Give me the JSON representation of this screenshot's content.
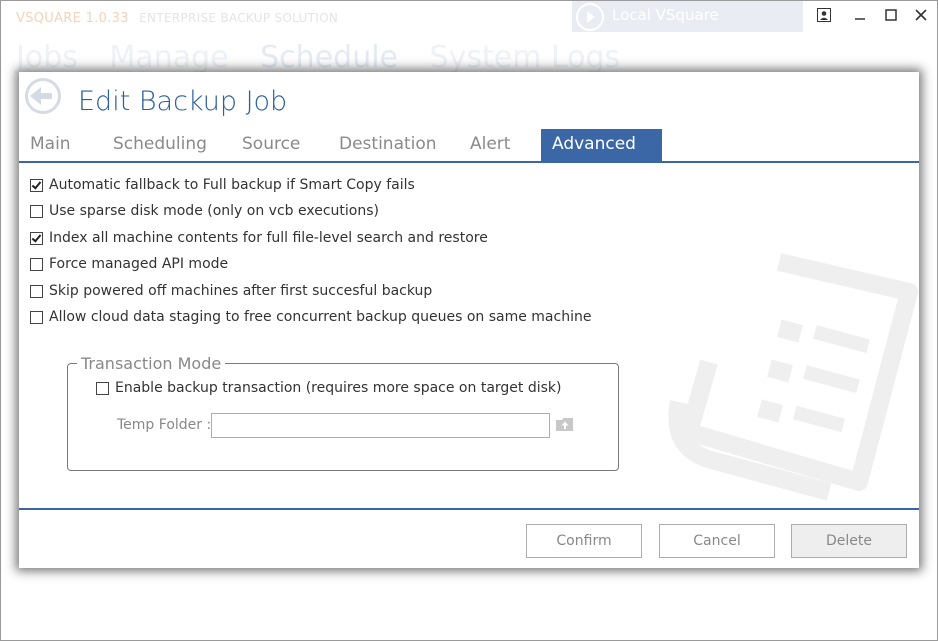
{
  "app": {
    "brand": "VSQUARE 1.0.33",
    "tagline": "ENTERPRISE BACKUP SOLUTION",
    "instance_label": "Local VSquare",
    "bg_tabs": [
      "Jobs",
      "Manage",
      "Schedule",
      "System Logs"
    ]
  },
  "dialog": {
    "title": "Edit Backup Job",
    "tabs": [
      {
        "label": "Main"
      },
      {
        "label": "Scheduling"
      },
      {
        "label": "Source"
      },
      {
        "label": "Destination"
      },
      {
        "label": "Alert"
      },
      {
        "label": "Advanced",
        "active": true
      }
    ],
    "options": [
      {
        "label": "Automatic fallback to Full backup if Smart Copy fails",
        "checked": true
      },
      {
        "label": "Use sparse disk mode (only on vcb executions)",
        "checked": false
      },
      {
        "label": "Index all machine contents for full file-level search and restore",
        "checked": true
      },
      {
        "label": "Force managed API mode",
        "checked": false
      },
      {
        "label": "Skip powered off machines after first succesful backup",
        "checked": false
      },
      {
        "label": "Allow cloud data staging to free concurrent backup queues on same machine",
        "checked": false
      }
    ],
    "transaction": {
      "legend": "Transaction Mode",
      "enable_label": "Enable backup transaction (requires more space on target disk)",
      "enable_checked": false,
      "temp_folder_label": "Temp Folder :",
      "temp_folder_value": ""
    },
    "buttons": {
      "confirm": "Confirm",
      "cancel": "Cancel",
      "delete": "Delete"
    }
  },
  "icons": {
    "back": "back-arrow-icon",
    "browse": "folder-upload-icon",
    "watermark": "document-list-icon",
    "minimize": "minimize-icon",
    "maximize": "maximize-icon",
    "close": "close-icon",
    "user": "user-icon"
  },
  "colors": {
    "accent": "#3b67a6",
    "title": "#2b5e9c",
    "muted_text": "#888888"
  }
}
